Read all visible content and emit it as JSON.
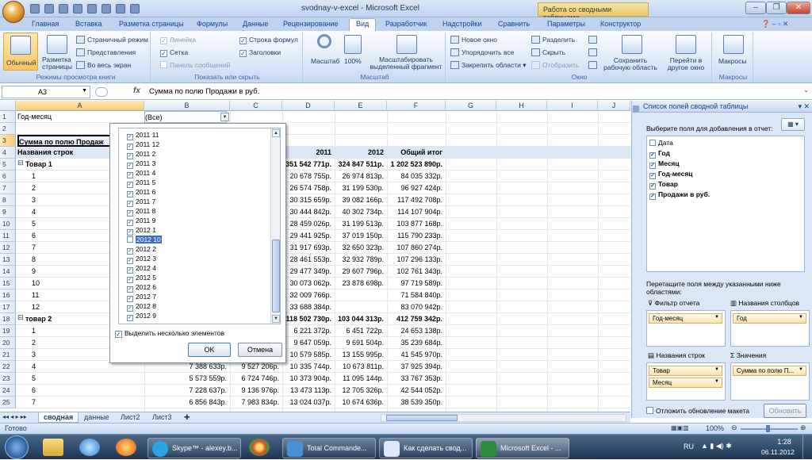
{
  "window": {
    "title": "svodnay-v-excel - Microsoft Excel",
    "context_tab_group": "Работа со сводными таблицами"
  },
  "ribbon_tabs": [
    "Главная",
    "Вставка",
    "Разметка страницы",
    "Формулы",
    "Данные",
    "Рецензирование",
    "Вид",
    "Разработчик",
    "Надстройки",
    "Сравнить",
    "Параметры",
    "Конструктор"
  ],
  "active_tab": "Вид",
  "ribbon": {
    "views": {
      "normal": "Обычный",
      "page_layout": "Разметка страницы",
      "page_break": "Страничный режим",
      "custom": "Представления",
      "fullscreen": "Во весь экран",
      "label": "Режимы просмотра книги"
    },
    "show": {
      "ruler": "Линейка",
      "gridlines": "Сетка",
      "msgbar": "Панель сообщений",
      "formula_bar": "Строка формул",
      "headings": "Заголовки",
      "label": "Показать или скрыть"
    },
    "zoom": {
      "zoom": "Масштаб",
      "hundred": "100%",
      "to_sel": "Масштабировать выделенный фрагмент",
      "label": "Масштаб"
    },
    "window": {
      "new": "Новое окно",
      "arrange": "Упорядочить все",
      "freeze": "Закрепить области",
      "split": "Разделить",
      "hide": "Скрыть",
      "unhide": "Отобразить",
      "save_ws": "Сохранить рабочую область",
      "switch": "Перейти в другое окно",
      "label": "Окно"
    },
    "macros": {
      "macros": "Макросы",
      "label": "Макросы"
    }
  },
  "formula_bar": {
    "name_box": "A3",
    "fx": "fx",
    "formula": "Сумма по полю Продажи в руб."
  },
  "columns": [
    "A",
    "B",
    "C",
    "D",
    "E",
    "F",
    "G",
    "H",
    "I",
    "J"
  ],
  "row_numbers": [
    "1",
    "2",
    "3",
    "4",
    "5",
    "6",
    "7",
    "8",
    "9",
    "10",
    "11",
    "12",
    "13",
    "14",
    "15",
    "16",
    "17",
    "18",
    "19",
    "20",
    "21",
    "22",
    "23",
    "24",
    "25"
  ],
  "sheet": {
    "a1": "Год-месяц",
    "b1": "(Все)",
    "a3": "Сумма по полю Продаж",
    "a4": "Названия строк",
    "d4": "2011",
    "e4": "2012",
    "f4": "Общий итог",
    "group1": "Товар 1",
    "group2": "товар 2",
    "month_labels": [
      "1",
      "2",
      "3",
      "4",
      "5",
      "6",
      "7",
      "8",
      "9",
      "10",
      "11",
      "12"
    ],
    "group1_row": {
      "d": "351 542 771р.",
      "e": "324 847 511р.",
      "f": "1 202 523 890р."
    },
    "group1_rows": [
      {
        "d": "20 678 755р.",
        "e": "26 974 813р.",
        "f": "84 035 332р."
      },
      {
        "d": "26 574 758р.",
        "e": "31 199 530р.",
        "f": "96 927 424р."
      },
      {
        "d": "30 315 659р.",
        "e": "39 082 166р.",
        "f": "117 492 708р."
      },
      {
        "d": "30 444 842р.",
        "e": "40 302 734р.",
        "f": "114 107 904р."
      },
      {
        "d": "28 459 026р.",
        "e": "31 199 513р.",
        "f": "103 877 168р."
      },
      {
        "d": "29 441 925р.",
        "e": "37 019 150р.",
        "f": "115 790 233р."
      },
      {
        "d": "31 917 693р.",
        "e": "32 650 323р.",
        "f": "107 860 274р."
      },
      {
        "d": "28 461 553р.",
        "e": "32 932 789р.",
        "f": "107 296 133р."
      },
      {
        "d": "29 477 349р.",
        "e": "29 607 796р.",
        "f": "102 761 343р."
      },
      {
        "d": "30 073 062р.",
        "e": "23 878 698р.",
        "f": "97 719 589р."
      },
      {
        "d": "32 009 766р.",
        "e": "",
        "f": "71 584 840р."
      },
      {
        "d": "33 688 384р.",
        "e": "",
        "f": "83 070 942р."
      }
    ],
    "group2_row": {
      "d": "118 502 730р.",
      "e": "103 044 313р.",
      "f": "412 759 342р."
    },
    "group2_rows": [
      {
        "b": "",
        "c": "",
        "d": "6 221 372р.",
        "e": "6 451 722р.",
        "f": "24 653 138р."
      },
      {
        "b": "",
        "c": "",
        "d": "9 647 059р.",
        "e": "9 691 504р.",
        "f": "35 239 684р."
      },
      {
        "b": "",
        "c": "",
        "d": "10 579 585р.",
        "e": "13 155 995р.",
        "f": "41 545 970р."
      },
      {
        "b": "7 388 633р.",
        "c": "9 527 206р.",
        "d": "10 335 744р.",
        "e": "10 673 811р.",
        "f": "37 925 394р."
      },
      {
        "b": "5 573 559р.",
        "c": "6 724 746р.",
        "d": "10 373 904р.",
        "e": "11 095 144р.",
        "f": "33 767 353р."
      },
      {
        "b": "7 228 637р.",
        "c": "9 136 976р.",
        "d": "13 473 113р.",
        "e": "12 705 326р.",
        "f": "42 544 052р."
      },
      {
        "b": "6 856 843р.",
        "c": "7 983 834р.",
        "d": "13 024 037р.",
        "e": "10 674 636р.",
        "f": "38 539 350р."
      }
    ]
  },
  "filter_popup": {
    "items": [
      {
        "label": "2011 11",
        "checked": true
      },
      {
        "label": "2011 12",
        "checked": true
      },
      {
        "label": "2011 2",
        "checked": true
      },
      {
        "label": "2011 3",
        "checked": true
      },
      {
        "label": "2011 4",
        "checked": true
      },
      {
        "label": "2011 5",
        "checked": true
      },
      {
        "label": "2011 6",
        "checked": true
      },
      {
        "label": "2011 7",
        "checked": true
      },
      {
        "label": "2011 8",
        "checked": true
      },
      {
        "label": "2011 9",
        "checked": true
      },
      {
        "label": "2012 1",
        "checked": true
      },
      {
        "label": "2012 10",
        "checked": false,
        "selected": true
      },
      {
        "label": "2012 2",
        "checked": true
      },
      {
        "label": "2012 3",
        "checked": true
      },
      {
        "label": "2012 4",
        "checked": true
      },
      {
        "label": "2012 5",
        "checked": true
      },
      {
        "label": "2012 6",
        "checked": true
      },
      {
        "label": "2012 7",
        "checked": true
      },
      {
        "label": "2012 8",
        "checked": true
      },
      {
        "label": "2012 9",
        "checked": true
      }
    ],
    "multi_select": "Выделить несколько элементов",
    "ok": "OK",
    "cancel": "Отмена"
  },
  "pivot_panel": {
    "title": "Список полей сводной таблицы",
    "choose": "Выберите поля для добавления в отчет:",
    "fields": [
      {
        "label": "Дата",
        "checked": false,
        "bold": false
      },
      {
        "label": "Год",
        "checked": true,
        "bold": true
      },
      {
        "label": "Месяц",
        "checked": true,
        "bold": true
      },
      {
        "label": "Год-месяц",
        "checked": true,
        "bold": true
      },
      {
        "label": "Товар",
        "checked": true,
        "bold": true
      },
      {
        "label": "Продажи в руб.",
        "checked": true,
        "bold": true
      }
    ],
    "drag_hint": "Перетащите поля между указанными ниже областями:",
    "report_filter": "Фильтр отчета",
    "column_labels": "Названия столбцов",
    "row_labels": "Названия строк",
    "values": "Значения",
    "filter_items": [
      "Год-месяц"
    ],
    "column_items": [
      "Год"
    ],
    "row_items": [
      "Товар",
      "Месяц"
    ],
    "value_items": [
      "Сумма по полю П..."
    ],
    "defer": "Отложить обновление макета",
    "update": "Обновить"
  },
  "sheet_tabs": [
    "сводная",
    "данные",
    "Лист2",
    "Лист3"
  ],
  "active_sheet": "сводная",
  "status": {
    "ready": "Готово",
    "zoom": "100%"
  },
  "taskbar": {
    "buttons": [
      "Skype™ - alexey.b...",
      "Total Commande...",
      "Как сделать свод...",
      "Microsoft Excel - ..."
    ],
    "lang": "RU",
    "time": "1:28",
    "date": "06.11.2012"
  }
}
